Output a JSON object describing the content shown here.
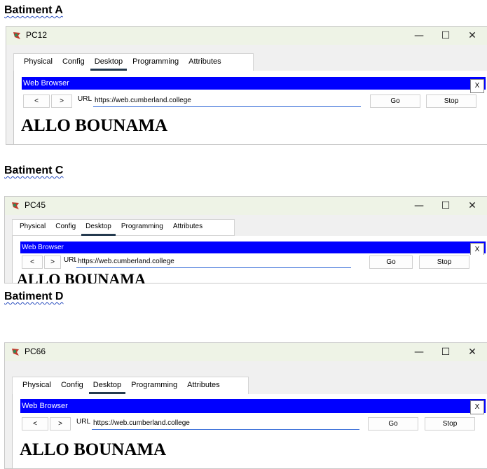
{
  "sections": [
    {
      "heading": "Batiment A",
      "window": {
        "title": "PC12",
        "tabs": [
          "Physical",
          "Config",
          "Desktop",
          "Programming",
          "Attributes"
        ],
        "active_tab": "Desktop",
        "browser_label": "Web Browser",
        "close_label": "X",
        "back_label": "<",
        "forward_label": ">",
        "url_label": "URL",
        "url_value": "https://web.cumberland.college",
        "go_label": "Go",
        "stop_label": "Stop",
        "page_text": "ALLO BOUNAMA"
      }
    },
    {
      "heading": "Batiment C",
      "window": {
        "title": "PC45",
        "tabs": [
          "Physical",
          "Config",
          "Desktop",
          "Programming",
          "Attributes"
        ],
        "active_tab": "Desktop",
        "browser_label": "Web Browser",
        "close_label": "X",
        "back_label": "<",
        "forward_label": ">",
        "url_label": "URL",
        "url_value": "https://web.cumberland.college",
        "go_label": "Go",
        "stop_label": "Stop",
        "page_text": "ALLO BOUNAMA"
      }
    },
    {
      "heading": "Batiment D",
      "window": {
        "title": "PC66",
        "tabs": [
          "Physical",
          "Config",
          "Desktop",
          "Programming",
          "Attributes"
        ],
        "active_tab": "Desktop",
        "browser_label": "Web Browser",
        "close_label": "X",
        "back_label": "<",
        "forward_label": ">",
        "url_label": "URL",
        "url_value": "https://web.cumberland.college",
        "go_label": "Go",
        "stop_label": "Stop",
        "page_text": "ALLO BOUNAMA"
      }
    }
  ],
  "window_controls": {
    "minimize": "—",
    "maximize": "☐",
    "close": "✕"
  },
  "colors": {
    "browser_bar": "#0000ff",
    "titlebar": "#eef3e6",
    "active_tab_underline": "#243a4f"
  },
  "icons": {
    "app_icon": "packet-tracer-pc-icon"
  }
}
